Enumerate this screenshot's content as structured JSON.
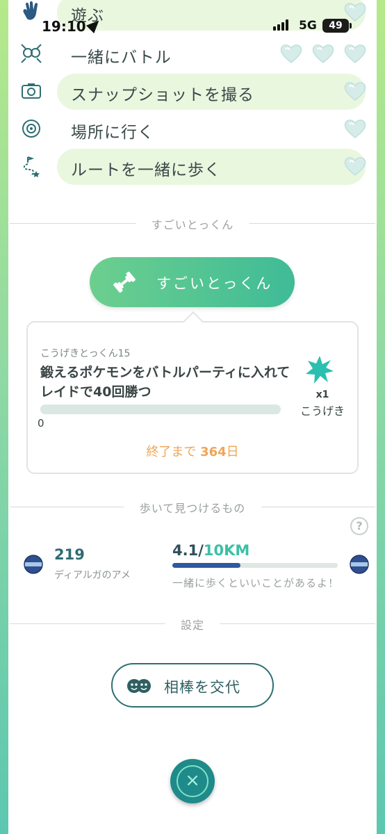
{
  "status_bar": {
    "time": "19:10",
    "network": "5G",
    "battery": "49"
  },
  "bond_rows": [
    {
      "label": "遊ぶ",
      "icon": "wave-hand-icon",
      "hearts": 1,
      "highlighted": true
    },
    {
      "label": "一緒にバトル",
      "icon": "battle-icon",
      "hearts": 3,
      "highlighted": false
    },
    {
      "label": "スナップショットを撮る",
      "icon": "camera-icon",
      "hearts": 1,
      "highlighted": true
    },
    {
      "label": "場所に行く",
      "icon": "location-icon",
      "hearts": 1,
      "highlighted": false
    },
    {
      "label": "ルートを一緒に歩く",
      "icon": "route-icon",
      "hearts": 1,
      "highlighted": true
    }
  ],
  "training": {
    "section_title": "すごいとっくん",
    "button_label": "すごいとっくん",
    "task": {
      "subtitle": "こうげきとっくん15",
      "title": "鍛えるポケモンをバトルパーティに入れてレイドで40回勝つ",
      "progress": 0,
      "progress_label": "0",
      "reward_count": "x1",
      "reward_label": "こうげき",
      "ends_prefix": "終了まで",
      "ends_value": "364",
      "ends_suffix": "日"
    }
  },
  "walk": {
    "section_title": "歩いて見つけるもの",
    "help_icon": "?",
    "candy_count": "219",
    "candy_label": "ディアルガのアメ",
    "km_current": "4.1",
    "km_sep": "/",
    "km_goal": "10KM",
    "km_progress": 0.41,
    "hint": "一緒に歩くといいことがあるよ！"
  },
  "settings": {
    "section_title": "設定",
    "swap_button_label": "相棒を交代"
  },
  "close_button": {
    "icon": "close-icon",
    "glyph": "×"
  },
  "colors": {
    "accent": "#3dbfa5",
    "orange": "#f0a557",
    "dark_teal": "#2d6f73",
    "pill_bg": "#eaf7df"
  }
}
